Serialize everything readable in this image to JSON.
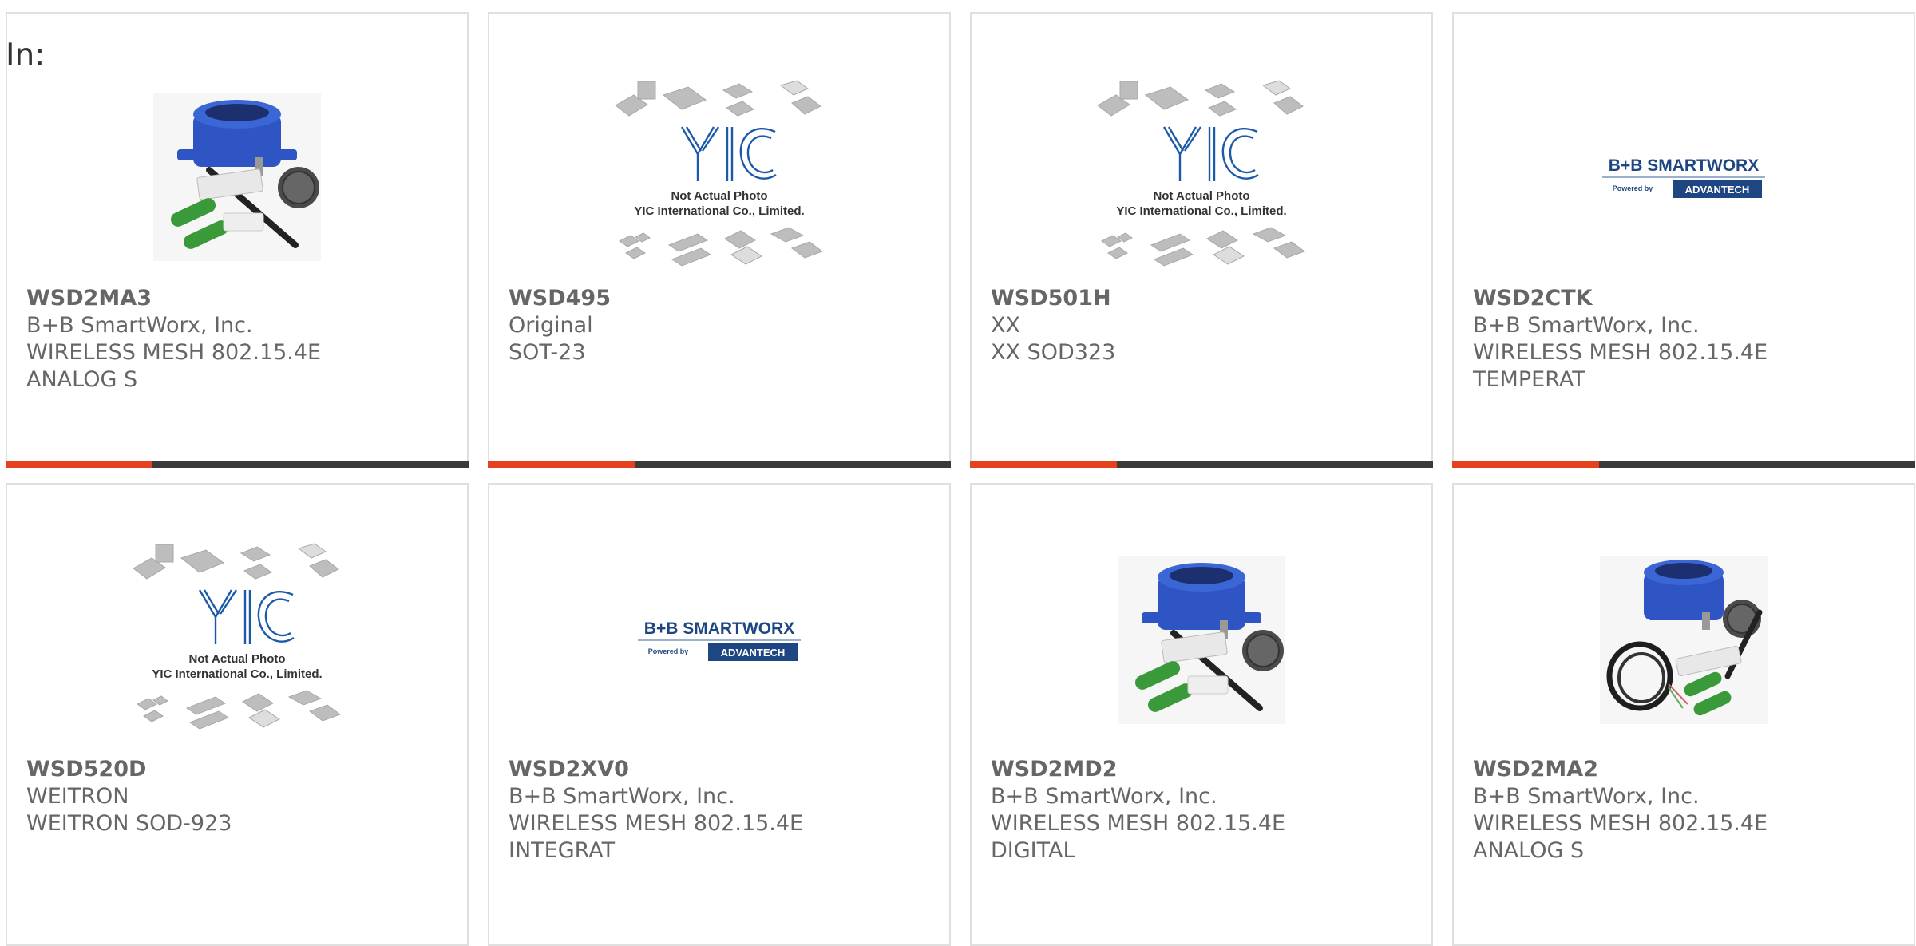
{
  "header": {
    "in_label": "In:"
  },
  "colors": {
    "accent": "#e5411e",
    "bar_dark": "#3a3a3a",
    "text": "#666666",
    "brand_blue": "#1b5aa8",
    "brand_navy": "#1e4682"
  },
  "yic_caption": {
    "line1": "Not Actual Photo",
    "line2": "YIC International Co., Limited."
  },
  "bb_logo": {
    "brand": "B+B SMARTWORX",
    "powered": "Powered by",
    "partner": "ADVANTECH"
  },
  "products": [
    {
      "part": "WSD2MA3",
      "maker": "B+B SmartWorx, Inc.",
      "desc1": "WIRELESS MESH 802.15.4E",
      "desc2": "ANALOG S",
      "image": "sensor-kit"
    },
    {
      "part": "WSD495",
      "maker": "Original",
      "desc1": "SOT-23",
      "desc2": "",
      "image": "yic-placeholder"
    },
    {
      "part": "WSD501H",
      "maker": "XX",
      "desc1": "XX SOD323",
      "desc2": "",
      "image": "yic-placeholder"
    },
    {
      "part": "WSD2CTK",
      "maker": "B+B SmartWorx, Inc.",
      "desc1": "WIRELESS MESH 802.15.4E",
      "desc2": "TEMPERAT",
      "image": "bb-logo"
    },
    {
      "part": "WSD520D",
      "maker": "WEITRON",
      "desc1": "WEITRON SOD-923",
      "desc2": "",
      "image": "yic-placeholder"
    },
    {
      "part": "WSD2XV0",
      "maker": "B+B SmartWorx, Inc.",
      "desc1": "WIRELESS MESH 802.15.4E",
      "desc2": "INTEGRAT",
      "image": "bb-logo"
    },
    {
      "part": "WSD2MD2",
      "maker": "B+B SmartWorx, Inc.",
      "desc1": "WIRELESS MESH 802.15.4E",
      "desc2": "DIGITAL",
      "image": "sensor-kit"
    },
    {
      "part": "WSD2MA2",
      "maker": "B+B SmartWorx, Inc.",
      "desc1": "WIRELESS MESH 802.15.4E",
      "desc2": "ANALOG S",
      "image": "sensor-kit-cable"
    }
  ]
}
